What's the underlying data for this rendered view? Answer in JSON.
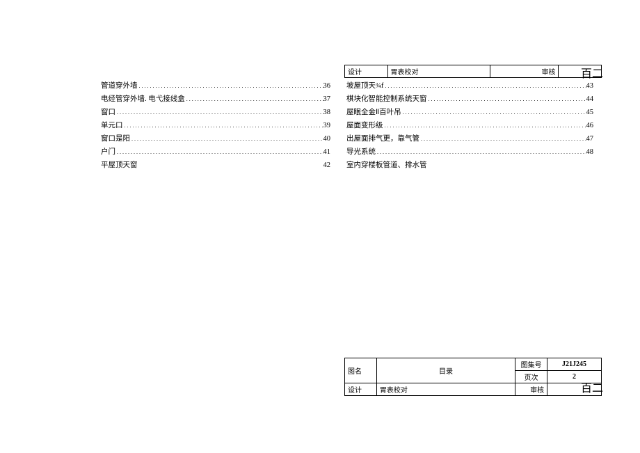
{
  "header": {
    "design_label": "设计",
    "check_label": "胃表校对",
    "review_label": "审核",
    "handwritten": "百二"
  },
  "toc_left": [
    {
      "label": "管道穿外墙",
      "page": "36"
    },
    {
      "label": "电经管穿外墙. 电弋接线盒",
      "page": "37"
    },
    {
      "label": "窗口",
      "page": "38"
    },
    {
      "label": "单元口",
      "page": "39"
    },
    {
      "label": "窗口是阳",
      "page": "40"
    },
    {
      "label": "户门",
      "page": "41"
    },
    {
      "label": "平屋顶天窗",
      "page": "42"
    }
  ],
  "toc_right": [
    {
      "label": "坡屋顶天¾f",
      "page": "43"
    },
    {
      "label": "棋块化智能控制系统天窗",
      "page": "44"
    },
    {
      "label": "屋眠全金Ⅱ百叶吊",
      "page": "45"
    },
    {
      "label": "屋面变形级",
      "page": "46"
    },
    {
      "label": "出屋面排气更，靠气管",
      "page": "47"
    },
    {
      "label": "导光系统",
      "page": "48"
    },
    {
      "label": "室内穿楼板管道、排水管",
      "page": "",
      "no_page": true,
      "trailing": "\""
    }
  ],
  "footer": {
    "figname_label": "图名",
    "figname_value": "目录",
    "setno_label": "图集号",
    "setno_value": "J21J245",
    "pageno_label": "页次",
    "pageno_value": "2",
    "design_label": "设计",
    "check_label": "胃表校对",
    "review_label": "审核",
    "handwritten": "百二"
  },
  "dots": "..............................................................................."
}
